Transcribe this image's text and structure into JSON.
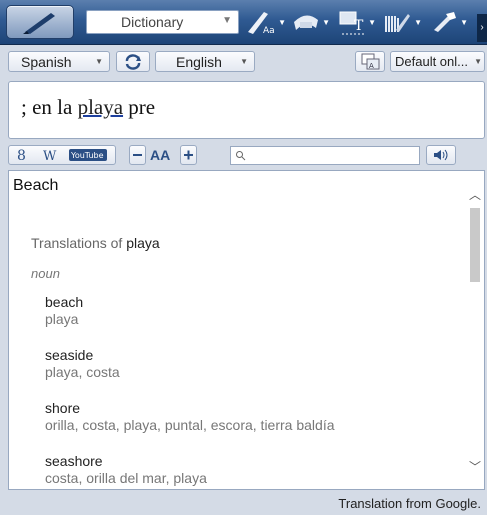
{
  "toolbar": {
    "dictionary_select": "Dictionary",
    "icons": [
      "logo-pen-icon",
      "text-style-icon",
      "capture-icon",
      "ocr-icon",
      "barcode-icon",
      "tools-icon"
    ]
  },
  "language_bar": {
    "source_language": "Spanish",
    "target_language": "English",
    "output_mode": "Default onl..."
  },
  "input": {
    "before": "; en la ",
    "highlight": "playa",
    "after": " pre"
  },
  "subbar": {
    "search_placeholder": "",
    "font_size_label": "AA"
  },
  "results": {
    "title": "Beach",
    "translations_heading": "Translations of",
    "translations_term": "playa",
    "part_of_speech": "noun",
    "entries": [
      {
        "word": "beach",
        "synonyms": "playa"
      },
      {
        "word": "seaside",
        "synonyms": "playa, costa"
      },
      {
        "word": "shore",
        "synonyms": "orilla, costa, playa, puntal, escora, tierra baldía"
      },
      {
        "word": "seashore",
        "synonyms": "costa, orilla del mar, playa"
      }
    ]
  },
  "status": {
    "text": "Translation from Google."
  }
}
